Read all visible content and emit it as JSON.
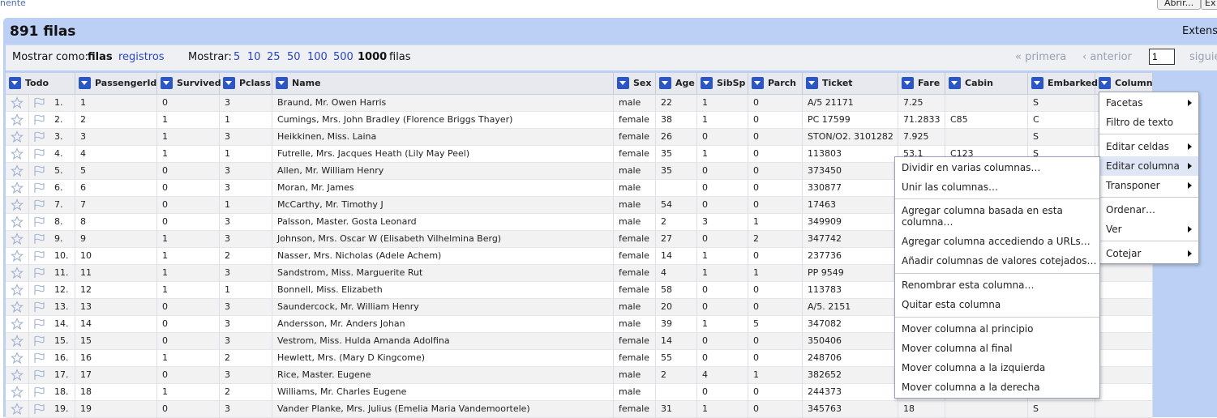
{
  "top": {
    "left_link": "nente",
    "open_button": "Abrir...",
    "ex_button": "Ex"
  },
  "header": {
    "row_count": "891 filas",
    "extensions_label": "Extensi"
  },
  "options": {
    "show_as_label": "Mostrar como:",
    "rows_mode": "filas",
    "records_mode": "registros",
    "show_label": "Mostrar:",
    "page_sizes": [
      "5",
      "10",
      "25",
      "50",
      "100",
      "500",
      "1000"
    ],
    "selected_page_size": "1000",
    "rows_suffix": "filas",
    "first": "« primera",
    "previous": "‹ anterior",
    "page_number": "1",
    "next": "siguie"
  },
  "columns": [
    "Todo",
    "PassengerId",
    "Survived",
    "Pclass",
    "Name",
    "Sex",
    "Age",
    "SibSp",
    "Parch",
    "Ticket",
    "Fare",
    "Cabin",
    "Embarked",
    "Column"
  ],
  "rows": [
    {
      "n": "1.",
      "id": "1",
      "surv": "0",
      "pc": "3",
      "name": "Braund, Mr. Owen Harris",
      "sex": "male",
      "age": "22",
      "sib": "1",
      "par": "0",
      "ticket": "A/5 21171",
      "fare": "7.25",
      "cabin": "",
      "emb": "S"
    },
    {
      "n": "2.",
      "id": "2",
      "surv": "1",
      "pc": "1",
      "name": "Cumings, Mrs. John Bradley (Florence Briggs Thayer)",
      "sex": "female",
      "age": "38",
      "sib": "1",
      "par": "0",
      "ticket": "PC 17599",
      "fare": "71.2833",
      "cabin": "C85",
      "emb": "C"
    },
    {
      "n": "3.",
      "id": "3",
      "surv": "1",
      "pc": "3",
      "name": "Heikkinen, Miss. Laina",
      "sex": "female",
      "age": "26",
      "sib": "0",
      "par": "0",
      "ticket": "STON/O2. 3101282",
      "fare": "7.925",
      "cabin": "",
      "emb": "S"
    },
    {
      "n": "4.",
      "id": "4",
      "surv": "1",
      "pc": "1",
      "name": "Futrelle, Mrs. Jacques Heath (Lily May Peel)",
      "sex": "female",
      "age": "35",
      "sib": "1",
      "par": "0",
      "ticket": "113803",
      "fare": "53.1",
      "cabin": "C123",
      "emb": "S"
    },
    {
      "n": "5.",
      "id": "5",
      "surv": "0",
      "pc": "3",
      "name": "Allen, Mr. William Henry",
      "sex": "male",
      "age": "35",
      "sib": "0",
      "par": "0",
      "ticket": "373450",
      "fare": "",
      "cabin": "",
      "emb": ""
    },
    {
      "n": "6.",
      "id": "6",
      "surv": "0",
      "pc": "3",
      "name": "Moran, Mr. James",
      "sex": "male",
      "age": "",
      "sib": "0",
      "par": "0",
      "ticket": "330877",
      "fare": "",
      "cabin": "",
      "emb": ""
    },
    {
      "n": "7.",
      "id": "7",
      "surv": "0",
      "pc": "1",
      "name": "McCarthy, Mr. Timothy J",
      "sex": "male",
      "age": "54",
      "sib": "0",
      "par": "0",
      "ticket": "17463",
      "fare": "",
      "cabin": "",
      "emb": ""
    },
    {
      "n": "8.",
      "id": "8",
      "surv": "0",
      "pc": "3",
      "name": "Palsson, Master. Gosta Leonard",
      "sex": "male",
      "age": "2",
      "sib": "3",
      "par": "1",
      "ticket": "349909",
      "fare": "",
      "cabin": "",
      "emb": ""
    },
    {
      "n": "9.",
      "id": "9",
      "surv": "1",
      "pc": "3",
      "name": "Johnson, Mrs. Oscar W (Elisabeth Vilhelmina Berg)",
      "sex": "female",
      "age": "27",
      "sib": "0",
      "par": "2",
      "ticket": "347742",
      "fare": "",
      "cabin": "",
      "emb": ""
    },
    {
      "n": "10.",
      "id": "10",
      "surv": "1",
      "pc": "2",
      "name": "Nasser, Mrs. Nicholas (Adele Achem)",
      "sex": "female",
      "age": "14",
      "sib": "1",
      "par": "0",
      "ticket": "237736",
      "fare": "",
      "cabin": "",
      "emb": ""
    },
    {
      "n": "11.",
      "id": "11",
      "surv": "1",
      "pc": "3",
      "name": "Sandstrom, Miss. Marguerite Rut",
      "sex": "female",
      "age": "4",
      "sib": "1",
      "par": "1",
      "ticket": "PP 9549",
      "fare": "",
      "cabin": "",
      "emb": ""
    },
    {
      "n": "12.",
      "id": "12",
      "surv": "1",
      "pc": "1",
      "name": "Bonnell, Miss. Elizabeth",
      "sex": "female",
      "age": "58",
      "sib": "0",
      "par": "0",
      "ticket": "113783",
      "fare": "",
      "cabin": "",
      "emb": ""
    },
    {
      "n": "13.",
      "id": "13",
      "surv": "0",
      "pc": "3",
      "name": "Saundercock, Mr. William Henry",
      "sex": "male",
      "age": "20",
      "sib": "0",
      "par": "0",
      "ticket": "A/5. 2151",
      "fare": "",
      "cabin": "",
      "emb": ""
    },
    {
      "n": "14.",
      "id": "14",
      "surv": "0",
      "pc": "3",
      "name": "Andersson, Mr. Anders Johan",
      "sex": "male",
      "age": "39",
      "sib": "1",
      "par": "5",
      "ticket": "347082",
      "fare": "",
      "cabin": "",
      "emb": ""
    },
    {
      "n": "15.",
      "id": "15",
      "surv": "0",
      "pc": "3",
      "name": "Vestrom, Miss. Hulda Amanda Adolfina",
      "sex": "female",
      "age": "14",
      "sib": "0",
      "par": "0",
      "ticket": "350406",
      "fare": "",
      "cabin": "",
      "emb": ""
    },
    {
      "n": "16.",
      "id": "16",
      "surv": "1",
      "pc": "2",
      "name": "Hewlett, Mrs. (Mary D Kingcome)",
      "sex": "female",
      "age": "55",
      "sib": "0",
      "par": "0",
      "ticket": "248706",
      "fare": "",
      "cabin": "",
      "emb": ""
    },
    {
      "n": "17.",
      "id": "17",
      "surv": "0",
      "pc": "3",
      "name": "Rice, Master. Eugene",
      "sex": "male",
      "age": "2",
      "sib": "4",
      "par": "1",
      "ticket": "382652",
      "fare": "",
      "cabin": "",
      "emb": ""
    },
    {
      "n": "18.",
      "id": "18",
      "surv": "1",
      "pc": "2",
      "name": "Williams, Mr. Charles Eugene",
      "sex": "male",
      "age": "",
      "sib": "0",
      "par": "0",
      "ticket": "244373",
      "fare": "",
      "cabin": "",
      "emb": ""
    },
    {
      "n": "19.",
      "id": "19",
      "surv": "0",
      "pc": "3",
      "name": "Vander Planke, Mrs. Julius (Emelia Maria Vandemoortele)",
      "sex": "female",
      "age": "31",
      "sib": "1",
      "par": "0",
      "ticket": "345763",
      "fare": "18",
      "cabin": "",
      "emb": "S"
    }
  ],
  "column_menu": {
    "facets": "Facetas",
    "text_filter": "Filtro de texto",
    "edit_cells": "Editar celdas",
    "edit_column": "Editar columna",
    "transpose": "Transponer",
    "sort": "Ordenar…",
    "view": "Ver",
    "reconcile": "Cotejar"
  },
  "edit_column_submenu": {
    "split": "Dividir en varias columnas…",
    "join": "Unir las columnas…",
    "add_based_line1": "Agregar columna basada en esta",
    "add_based_line2": "columna…",
    "add_by_url": "Agregar columna accediendo a URLs…",
    "add_reconciled": "Añadir columnas de valores cotejados…",
    "rename": "Renombrar esta columna…",
    "remove": "Quitar esta columna",
    "move_first": "Mover columna al principio",
    "move_last": "Mover columna al final",
    "move_left": "Mover columna a la izquierda",
    "move_right": "Mover columna a la derecha"
  },
  "colors": {
    "panel_bg": "#bcd0f6",
    "header_bg": "#e7e9ee",
    "dropdown_btn": "#2a56c6",
    "link": "#2a45c8",
    "menu_highlight": "#dfe7f7"
  }
}
